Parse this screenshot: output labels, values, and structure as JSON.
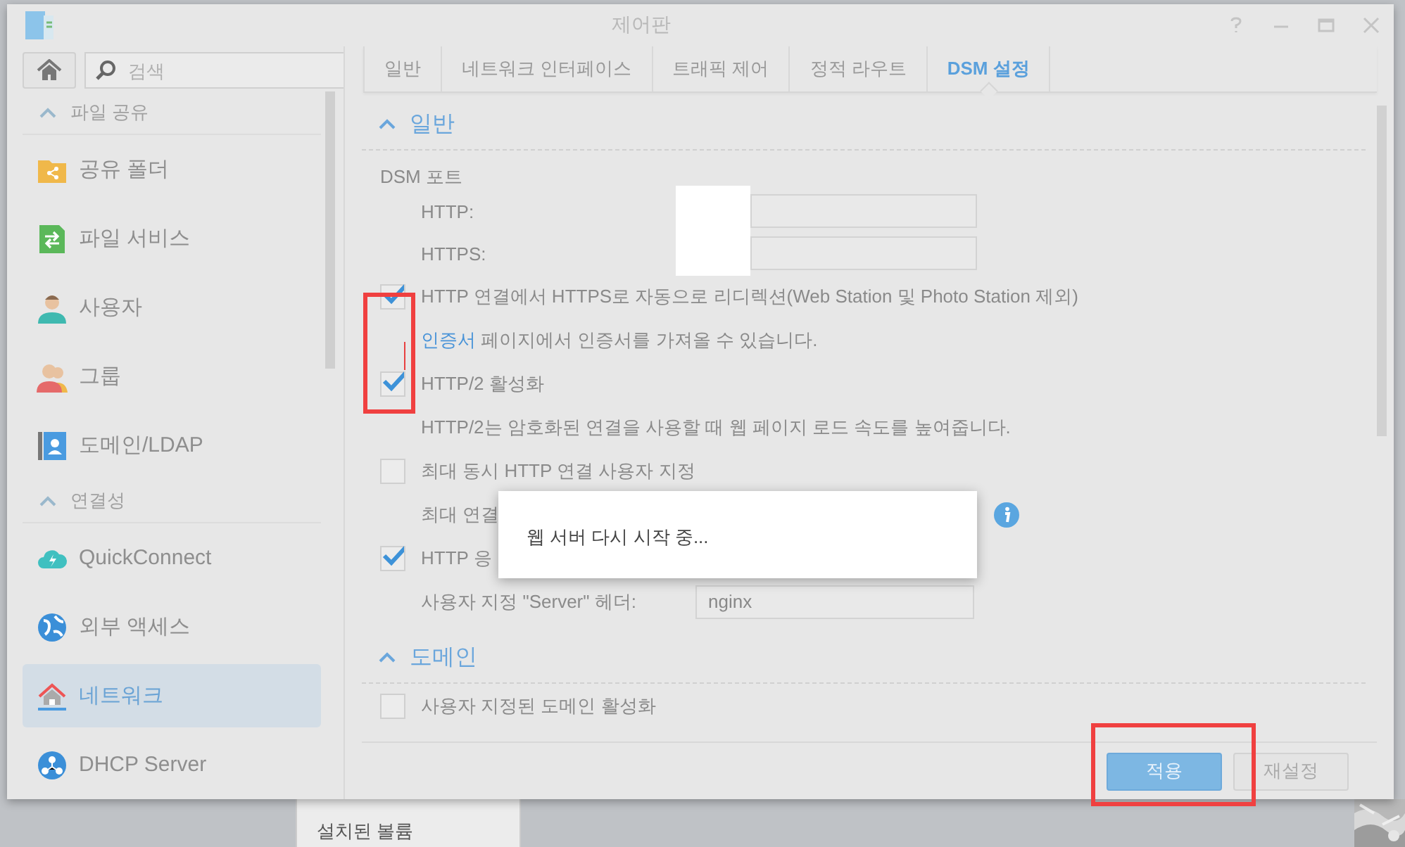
{
  "window": {
    "title": "제어판"
  },
  "sidebar": {
    "search": {
      "placeholder": "검색"
    },
    "groups": [
      {
        "title": "파일 공유",
        "expanded": true,
        "items": [
          {
            "label": "공유 폴더",
            "selected": false
          },
          {
            "label": "파일 서비스",
            "selected": false
          },
          {
            "label": "사용자",
            "selected": false
          },
          {
            "label": "그룹",
            "selected": false
          },
          {
            "label": "도메인/LDAP",
            "selected": false
          }
        ]
      },
      {
        "title": "연결성",
        "expanded": true,
        "items": [
          {
            "label": "QuickConnect",
            "selected": false
          },
          {
            "label": "외부 액세스",
            "selected": false
          },
          {
            "label": "네트워크",
            "selected": true
          },
          {
            "label": "DHCP Server",
            "selected": false
          }
        ]
      }
    ]
  },
  "tabs": [
    {
      "label": "일반",
      "selected": false
    },
    {
      "label": "네트워크 인터페이스",
      "selected": false
    },
    {
      "label": "트래픽 제어",
      "selected": false
    },
    {
      "label": "정적 라우트",
      "selected": false
    },
    {
      "label": "DSM 설정",
      "selected": true
    }
  ],
  "general": {
    "title": "일반",
    "expanded": true,
    "subheading": "DSM 포트",
    "ports": [
      {
        "label": "HTTP:"
      },
      {
        "label": "HTTPS:"
      }
    ],
    "rows": [
      {
        "kind": "checkbox",
        "label": "HTTP 연결에서 HTTPS로 자동으로 리디렉션(Web Station 및 Photo Station 제외)",
        "checked": true
      },
      {
        "kind": "note",
        "link": "인증서",
        "text": "페이지에서 인증서를 가져올 수 있습니다."
      },
      {
        "kind": "checkbox",
        "label": "HTTP/2 활성화",
        "checked": true
      },
      {
        "kind": "note",
        "text": "HTTP/2는 암호화된 연결을 사용할 때 웹 페이지 로드 속도를 높여줍니다."
      },
      {
        "kind": "checkbox",
        "label": "최대 동시 HTTP 연결 사용자 지정",
        "checked": false
      },
      {
        "kind": "limit",
        "label": "최대 연결",
        "info": true
      },
      {
        "kind": "checkbox",
        "label": "HTTP 응",
        "checked": true
      },
      {
        "kind": "field",
        "label": "사용자 지정 \"Server\" 헤더:",
        "value": "nginx"
      }
    ]
  },
  "domain": {
    "title": "도메인",
    "expanded": true,
    "rows": [
      {
        "kind": "checkbox",
        "label": "사용자 지정된 도메인 활성화",
        "checked": false
      }
    ]
  },
  "footer": {
    "buttons": [
      {
        "label": "적용",
        "kind": "primary"
      },
      {
        "label": "재설정",
        "kind": "secondary"
      }
    ]
  },
  "dialog": {
    "message": "웹 서버 다시 시작 중..."
  },
  "background_window": {
    "label": "설치된 볼륨"
  }
}
